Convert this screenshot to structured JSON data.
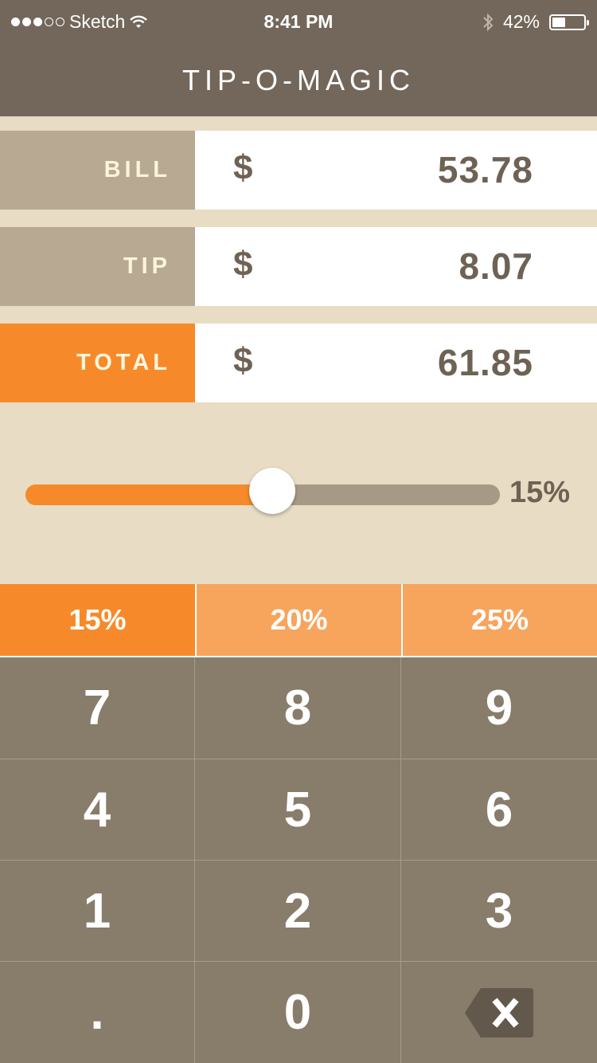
{
  "status": {
    "carrier": "Sketch",
    "time": "8:41 PM",
    "battery_text": "42%",
    "battery_level": 0.42,
    "signal_dots": [
      true,
      true,
      true,
      false,
      false
    ]
  },
  "header": {
    "title": "TIP-O-MAGIC"
  },
  "rows": {
    "bill": {
      "label": "BILL",
      "currency": "$",
      "value": "53.78"
    },
    "tip": {
      "label": "TIP",
      "currency": "$",
      "value": "8.07"
    },
    "total": {
      "label": "TOTAL",
      "currency": "$",
      "value": "61.85"
    }
  },
  "slider": {
    "value_text": "15%",
    "fraction": 0.52
  },
  "presets": [
    {
      "label": "15%",
      "active": true
    },
    {
      "label": "20%",
      "active": false
    },
    {
      "label": "25%",
      "active": false
    }
  ],
  "keypad": {
    "keys": [
      "7",
      "8",
      "9",
      "4",
      "5",
      "6",
      "1",
      "2",
      "3",
      ".",
      "0"
    ]
  },
  "colors": {
    "header_bg": "#72675a",
    "accent": "#f68a2a",
    "accent_light": "#f7a45d",
    "background": "#e8dcc4",
    "label_bg": "#b8a992",
    "keypad_bg": "#887c6b",
    "text_dark": "#6e6254"
  }
}
